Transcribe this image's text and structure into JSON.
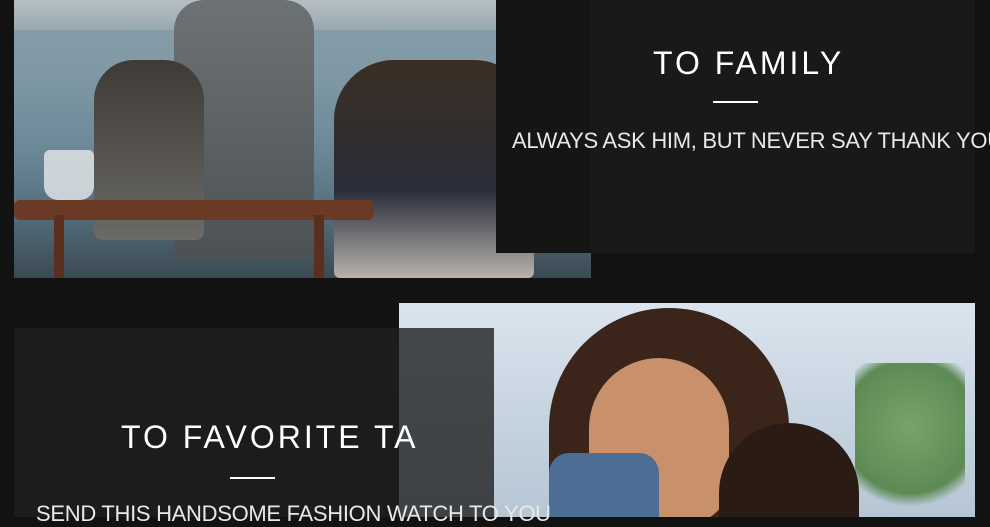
{
  "sections": [
    {
      "heading": "TO FAMILY",
      "text": "ALWAYS ASK HIM, BUT NEVER SAY THANK YOU."
    },
    {
      "heading": "TO FAVORITE TA",
      "text": "SEND THIS HANDSOME FASHION WATCH TO YOU"
    }
  ]
}
